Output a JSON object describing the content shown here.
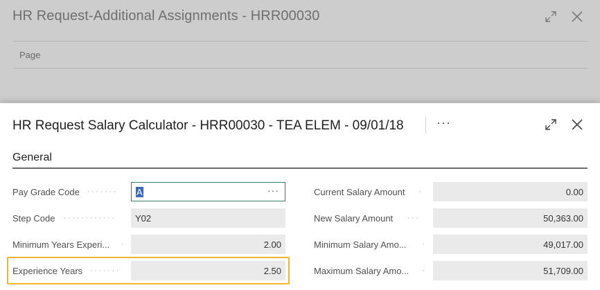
{
  "background_dialog": {
    "title": "HR Request-Additional Assignments - HRR00030",
    "menu_page": "Page",
    "expand_icon": "expand-icon",
    "close_icon": "close-icon"
  },
  "dialog": {
    "title": "HR Request Salary Calculator - HRR00030 - TEA ELEM - 09/01/18",
    "more_label": "···",
    "section_title": "General",
    "left_fields": [
      {
        "label": "Pay Grade Code",
        "value": "A"
      },
      {
        "label": "Step Code",
        "value": "Y02"
      },
      {
        "label": "Minimum Years Experi...",
        "value": "2.00"
      },
      {
        "label": "Experience Years",
        "value": "2.50"
      }
    ],
    "right_fields": [
      {
        "label": "Current Salary Amount",
        "value": "0.00"
      },
      {
        "label": "New Salary Amount",
        "value": "50,363.00"
      },
      {
        "label": "Minimum Salary Amo...",
        "value": "49,017.00"
      },
      {
        "label": "Maximum Salary Amo...",
        "value": "51,709.00"
      }
    ],
    "lookup_label": "···"
  },
  "colors": {
    "highlight": "#f0b429",
    "selection": "#3a6ab4",
    "active_border": "#3c7a6a"
  }
}
